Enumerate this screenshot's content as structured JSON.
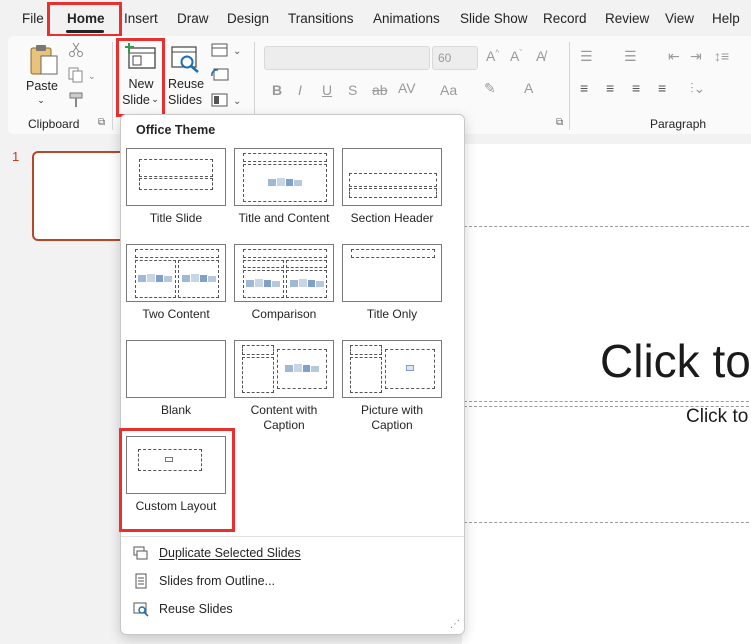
{
  "menu": {
    "tabs": [
      "File",
      "Home",
      "Insert",
      "Draw",
      "Design",
      "Transitions",
      "Animations",
      "Slide Show",
      "Record",
      "Review",
      "View",
      "Help"
    ],
    "active": "Home"
  },
  "ribbon": {
    "clipboard_group": "Clipboard",
    "paste_label": "Paste",
    "new_slide_label": "New",
    "new_slide_label2": "Slide",
    "reuse_label": "Reuse",
    "reuse_label2": "Slides",
    "font_size": "60",
    "paragraph_group": "Paragraph"
  },
  "thumbnail": {
    "number": "1"
  },
  "canvas": {
    "title_placeholder": "Click to",
    "subtitle_placeholder": "Click to"
  },
  "dropdown": {
    "header": "Office Theme",
    "layouts": [
      {
        "name": "Title Slide"
      },
      {
        "name": "Title and Content"
      },
      {
        "name": "Section Header"
      },
      {
        "name": "Two Content"
      },
      {
        "name": "Comparison"
      },
      {
        "name": "Title Only"
      },
      {
        "name": "Blank"
      },
      {
        "name": "Content with Caption"
      },
      {
        "name": "Picture with Caption"
      },
      {
        "name": "Custom Layout"
      }
    ],
    "actions": [
      {
        "label": "Duplicate Selected Slides",
        "icon": "duplicate-slides-icon"
      },
      {
        "label": "Slides from Outline...",
        "icon": "outline-icon"
      },
      {
        "label": "Reuse Slides",
        "icon": "reuse-slides-icon"
      }
    ]
  },
  "colors": {
    "accent": "#b7472a",
    "highlight": "#e8302f"
  }
}
